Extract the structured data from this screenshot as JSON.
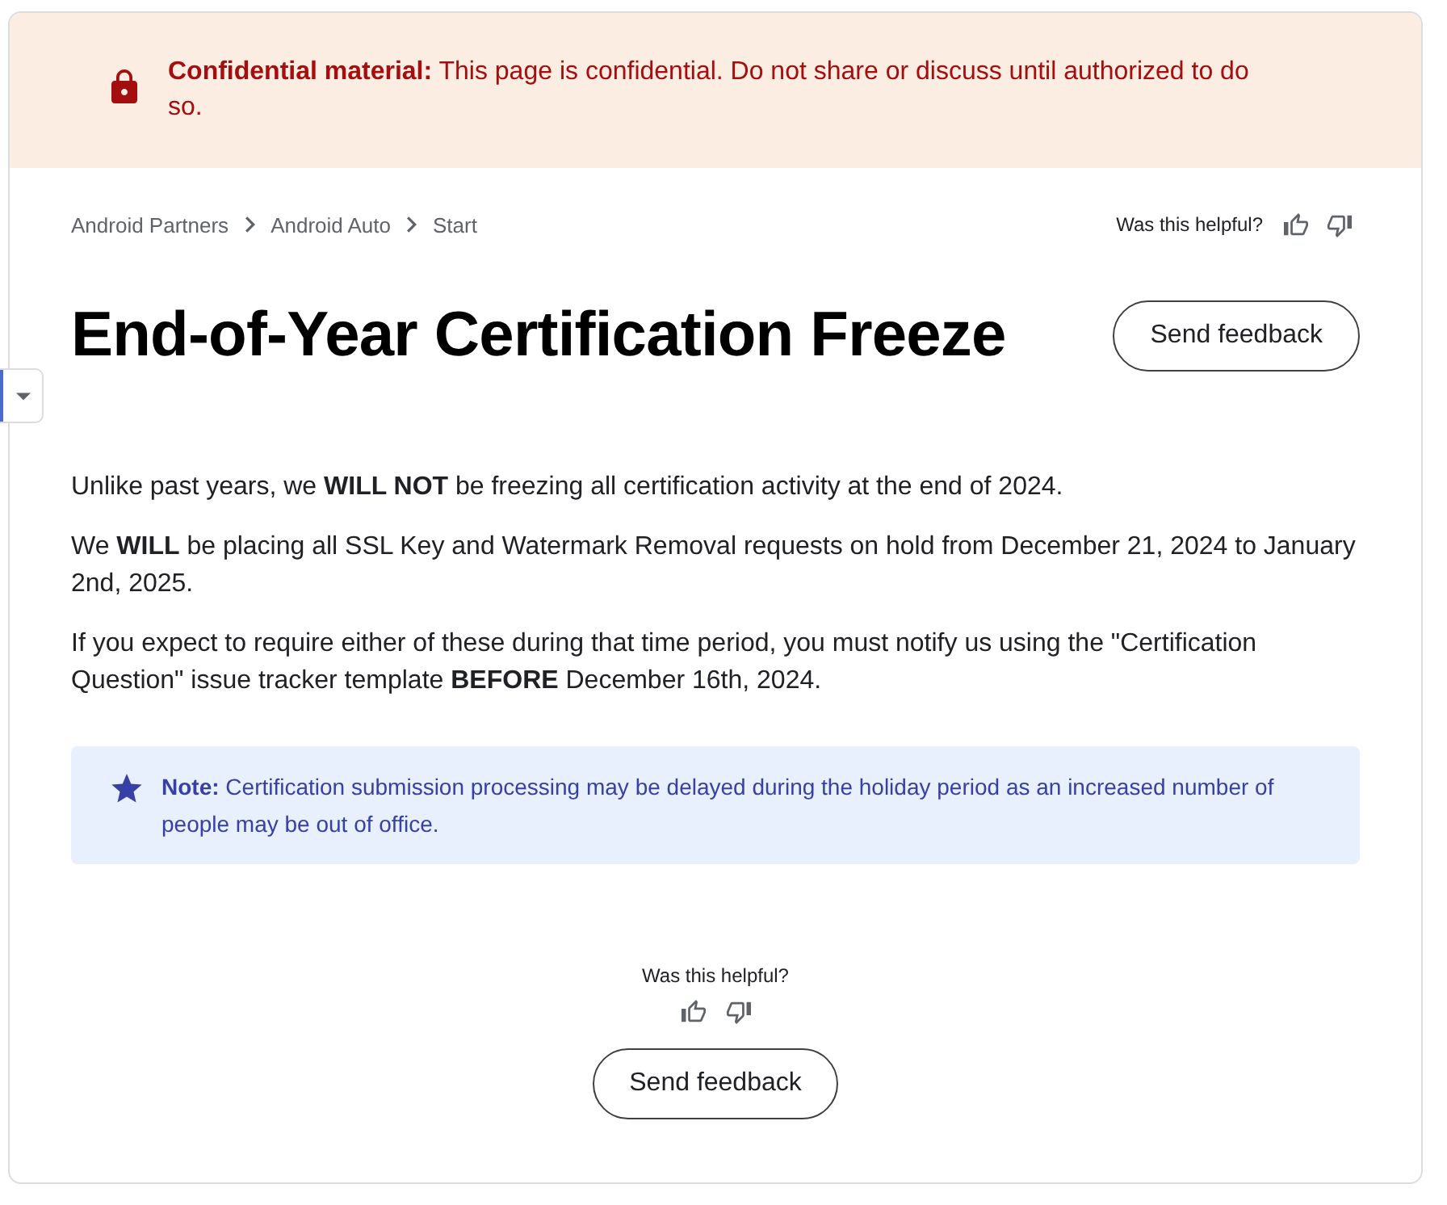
{
  "banner": {
    "text": "**Confidential material:** This page is confidential. Do not share or discuss until authorized to do so."
  },
  "breadcrumbs": [
    "Android Partners",
    "Android Auto",
    "Start"
  ],
  "header_feedback": {
    "prompt": "Was this helpful?"
  },
  "title": "End-of-Year Certification Freeze",
  "header_button": "Send feedback",
  "paragraphs": [
    "Unlike past years, we **WILL NOT** be freezing all certification activity at the end of 2024.",
    "We **WILL** be placing all SSL Key and Watermark Removal requests on hold from December 21, 2024 to January 2nd, 2025.",
    "If you expect to require either of these during that time period, you must notify us using the \"Certification Question\" issue tracker template **BEFORE** December 16th, 2024."
  ],
  "note": {
    "text": "**Note:** Certification submission processing may be delayed during the holiday period as an increased number of people may be out of office."
  },
  "footer_feedback": {
    "prompt": "Was this helpful?",
    "button": "Send feedback"
  }
}
